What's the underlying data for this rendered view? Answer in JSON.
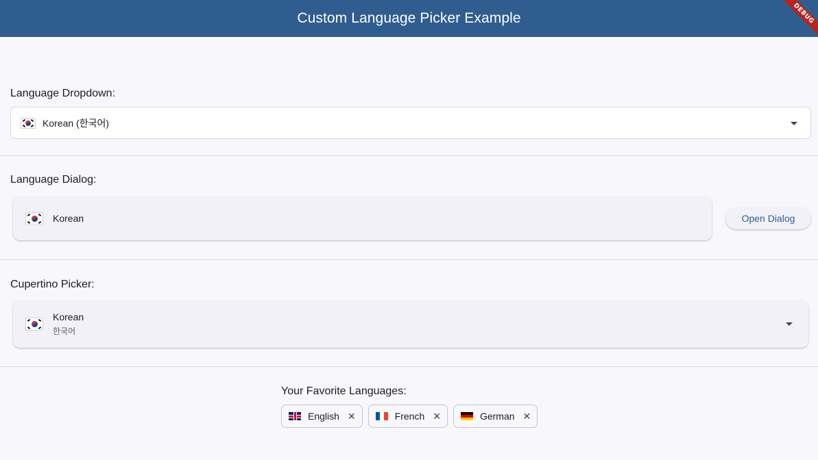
{
  "app": {
    "title": "Custom Language Picker Example",
    "debug_banner": "DEBUG"
  },
  "dropdown_section": {
    "label": "Language Dropdown:",
    "selected": "Korean (한국어)",
    "flag": "kr-flag-icon"
  },
  "dialog_section": {
    "label": "Language Dialog:",
    "selected": "Korean",
    "button_label": "Open Dialog"
  },
  "cupertino_section": {
    "label": "Cupertino Picker:",
    "selected_name": "Korean",
    "selected_native": "한국어"
  },
  "favorites": {
    "label": "Your Favorite Languages:",
    "chips": [
      {
        "label": "English",
        "flag": "gb-flag-icon"
      },
      {
        "label": "French",
        "flag": "fr-flag-icon"
      },
      {
        "label": "German",
        "flag": "de-flag-icon"
      }
    ],
    "remove_glyph": "✕"
  },
  "colors": {
    "primary": "#2f5d8f",
    "background": "#f8f7fc",
    "card": "#f2f1f7"
  }
}
